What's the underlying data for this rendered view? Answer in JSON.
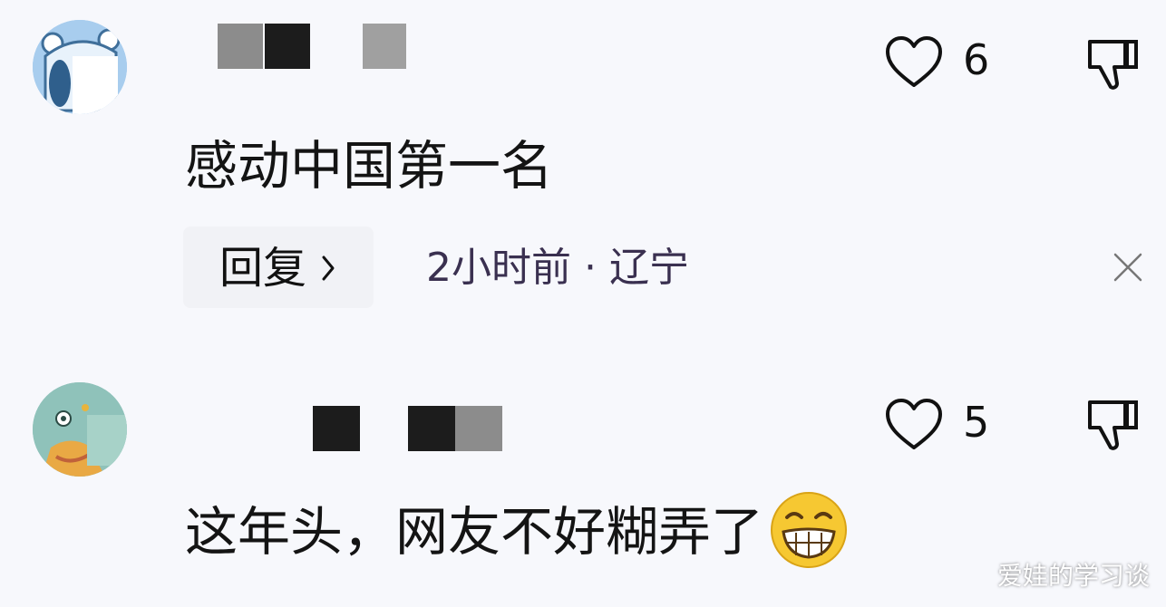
{
  "comments": [
    {
      "text": "感动中国第一名",
      "likes": "6",
      "reply_label": "回复",
      "meta": "2小时前 · 辽宁",
      "avatar_icon": "blue-bear-avatar",
      "username_redacted": true
    },
    {
      "text": "这年头，网友不好糊弄了",
      "likes": "5",
      "emoji_icon": "grinning-face-emoji",
      "avatar_icon": "green-creature-avatar",
      "username_redacted": true
    }
  ],
  "watermark": "爱娃的学习谈",
  "colors": {
    "background": "#f7f8fc",
    "text": "#141414",
    "meta": "#3a3050",
    "reply_bg": "#f1f2f6"
  }
}
